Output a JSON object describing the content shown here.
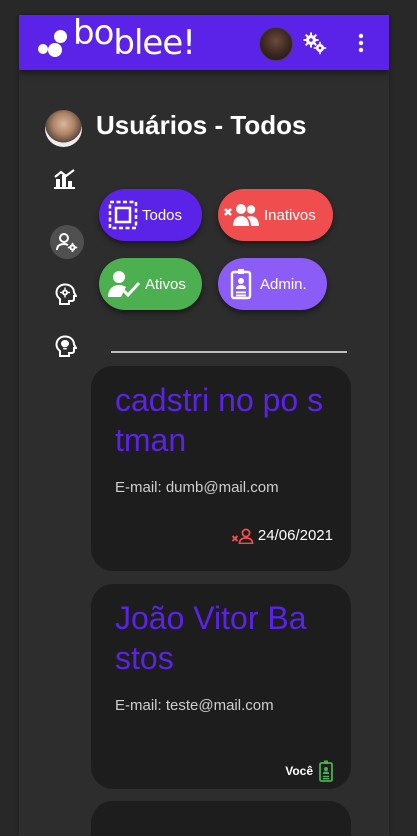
{
  "app": {
    "logo_text_a": "bo",
    "logo_text_b": "bl",
    "logo_text_c": "ee!"
  },
  "header": {
    "avatar_icon": "user-avatar",
    "settings_icon": "gears-icon",
    "menu_icon": "more-vert-icon"
  },
  "sidebar": {
    "items": [
      {
        "name": "profile-avatar"
      },
      {
        "name": "dashboard-chart-icon"
      },
      {
        "name": "manage-users-icon",
        "active": true
      },
      {
        "name": "head-gear-icon"
      },
      {
        "name": "head-idea-icon"
      }
    ]
  },
  "page": {
    "title": "Usuários - Todos"
  },
  "filters": [
    {
      "label": "Todos",
      "color": "#5b22e8",
      "icon": "select-all-icon"
    },
    {
      "label": "Inativos",
      "color": "#f04d4f",
      "icon": "users-x-icon"
    },
    {
      "label": "Ativos",
      "color": "#4caf50",
      "icon": "user-check-icon"
    },
    {
      "label": "Admin.",
      "color": "#8c5cf6",
      "icon": "badge-icon"
    }
  ],
  "users": [
    {
      "name": "cadstri no po stman",
      "email_label": "E-mail: dumb@mail.com",
      "footer_text": "24/06/2021",
      "footer_icon": "user-x-icon",
      "footer_color": "#f04d4f"
    },
    {
      "name": "João Vitor Ba stos",
      "email_label": "E-mail: teste@mail.com",
      "footer_text": "Você",
      "footer_icon": "badge-icon",
      "footer_color": "#4caf50"
    }
  ],
  "colors": {
    "primary": "#5b22e8",
    "background": "#2d2d2d",
    "card": "#1d1d1d"
  }
}
